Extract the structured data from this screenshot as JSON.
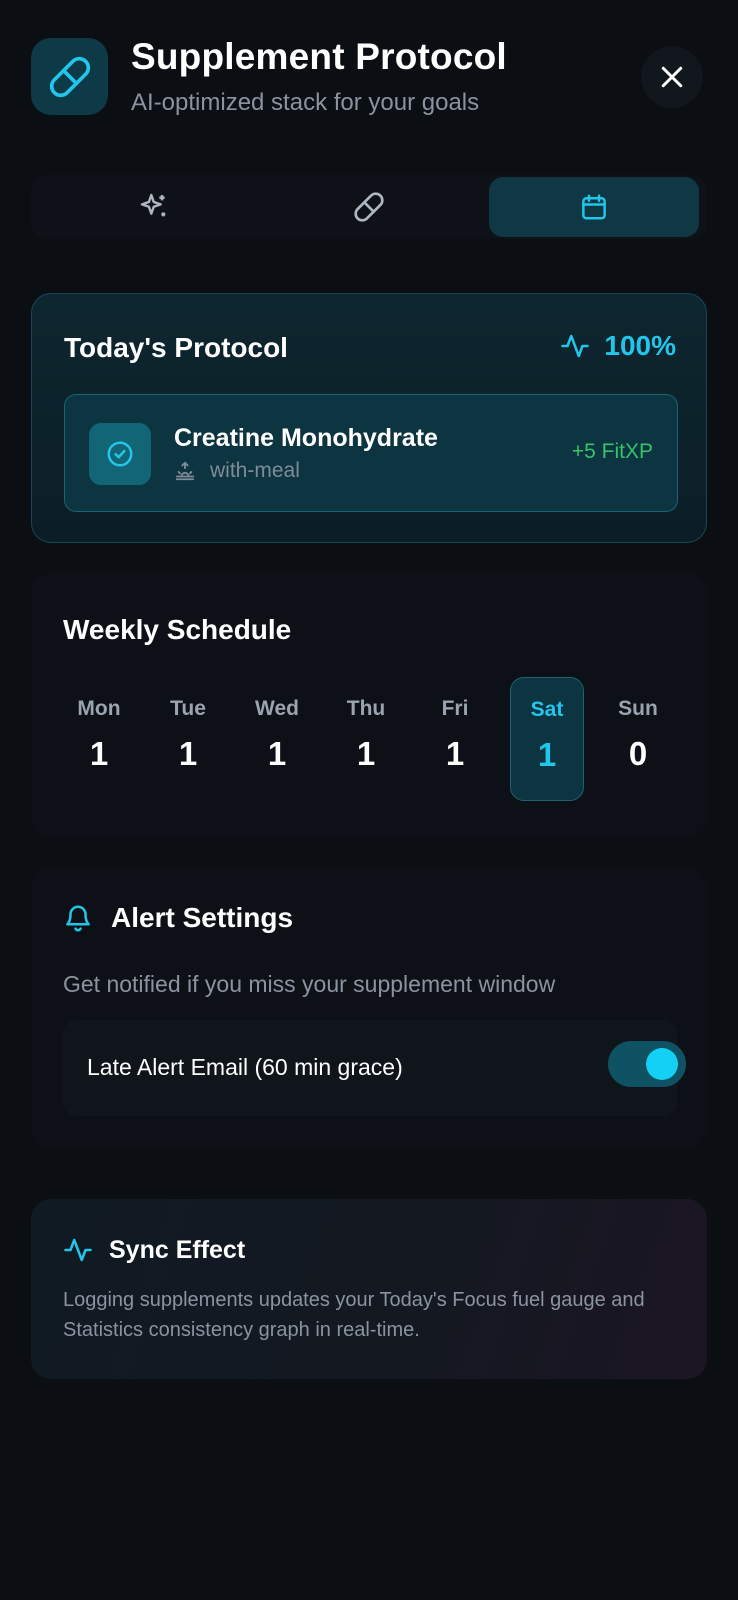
{
  "header": {
    "title": "Supplement Protocol",
    "subtitle": "AI-optimized stack for your goals",
    "app_icon": "pill-icon",
    "close_icon": "close-icon"
  },
  "tabs": [
    {
      "icon": "sparkles-icon",
      "active": false
    },
    {
      "icon": "pill-icon",
      "active": false
    },
    {
      "icon": "calendar-icon",
      "active": true
    }
  ],
  "today": {
    "title": "Today's Protocol",
    "progress": "100%",
    "progress_icon": "activity-icon",
    "items": [
      {
        "name": "Creatine Monohydrate",
        "timing": "with-meal",
        "timing_icon": "sunrise-icon",
        "reward": "+5 FitXP",
        "completed": true
      }
    ]
  },
  "weekly": {
    "title": "Weekly Schedule",
    "days": [
      {
        "name": "Mon",
        "count": "1",
        "active": false
      },
      {
        "name": "Tue",
        "count": "1",
        "active": false
      },
      {
        "name": "Wed",
        "count": "1",
        "active": false
      },
      {
        "name": "Thu",
        "count": "1",
        "active": false
      },
      {
        "name": "Fri",
        "count": "1",
        "active": false
      },
      {
        "name": "Sat",
        "count": "1",
        "active": true
      },
      {
        "name": "Sun",
        "count": "0",
        "active": false
      }
    ]
  },
  "alerts": {
    "title": "Alert Settings",
    "icon": "bell-icon",
    "description": "Get notified if you miss your supplement window",
    "late_alert_label": "Late Alert Email (60 min grace)",
    "late_alert_enabled": true
  },
  "sync": {
    "title": "Sync Effect",
    "icon": "activity-icon",
    "text": "Logging supplements updates your Today's Focus fuel gauge and Statistics consistency graph in real-time."
  },
  "colors": {
    "accent": "#22c6ea",
    "success": "#36c36a",
    "background": "#0b0e13"
  }
}
